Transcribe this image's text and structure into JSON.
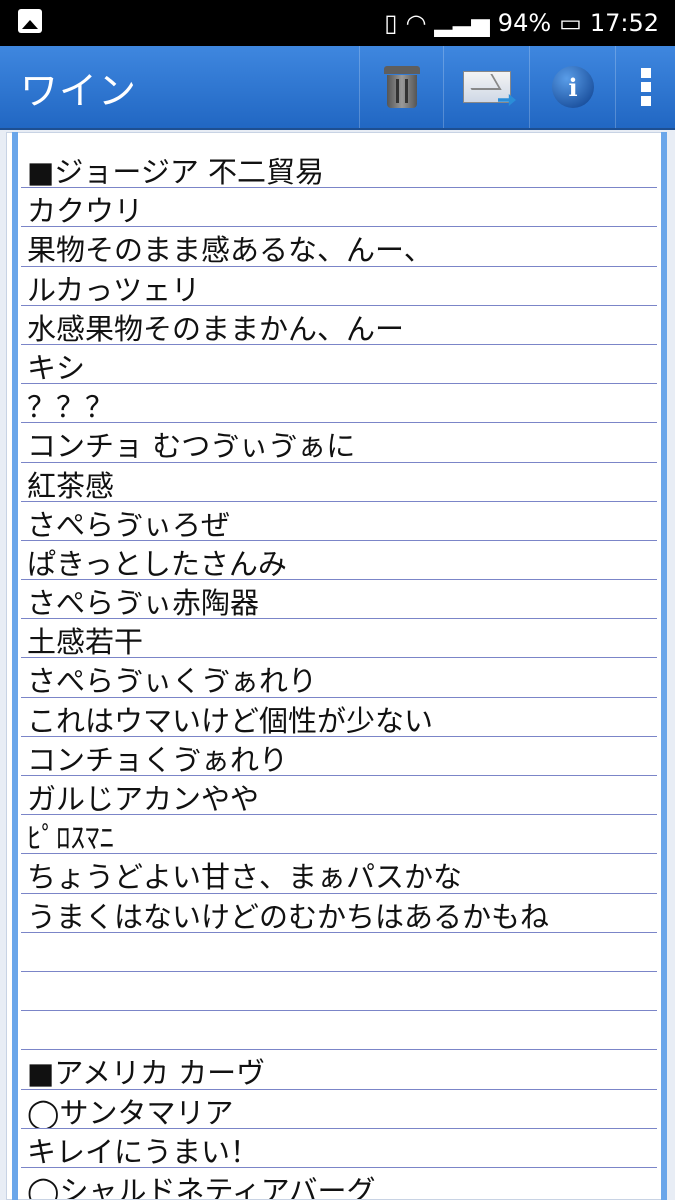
{
  "status_bar": {
    "battery": "94%",
    "time": "17:52"
  },
  "app_bar": {
    "title": "ワイン",
    "actions": [
      "trash-icon",
      "mail-icon",
      "info-icon",
      "overflow-menu-icon"
    ]
  },
  "note": {
    "lines": [
      "■ジョージア 不二貿易",
      "カクウリ",
      "果物そのまま感あるな、んー、",
      "ルカっツェリ",
      "水感果物そのままかん、んー",
      "キシ",
      "？？？",
      "コンチョ むつゔぃゔぁに",
      "紅茶感",
      "さぺらゔぃろぜ",
      "ぱきっとしたさんみ",
      "さぺらゔぃ赤陶器",
      "土感若干",
      "さぺらゔぃくゔぁれり",
      "これはウマいけど個性が少ない",
      "コンチョくゔぁれり",
      "ガルじアカンやや",
      "ﾋﾟﾛｽﾏﾆ",
      "ちょうどよい甘さ、まぁパスかな",
      "うまくはないけどのむかちはあるかもね",
      "",
      "",
      "",
      "■アメリカ カーヴ",
      "◯サンタマリア",
      "キレイにうまい！",
      "◯シャルドネティアバーグ"
    ]
  }
}
